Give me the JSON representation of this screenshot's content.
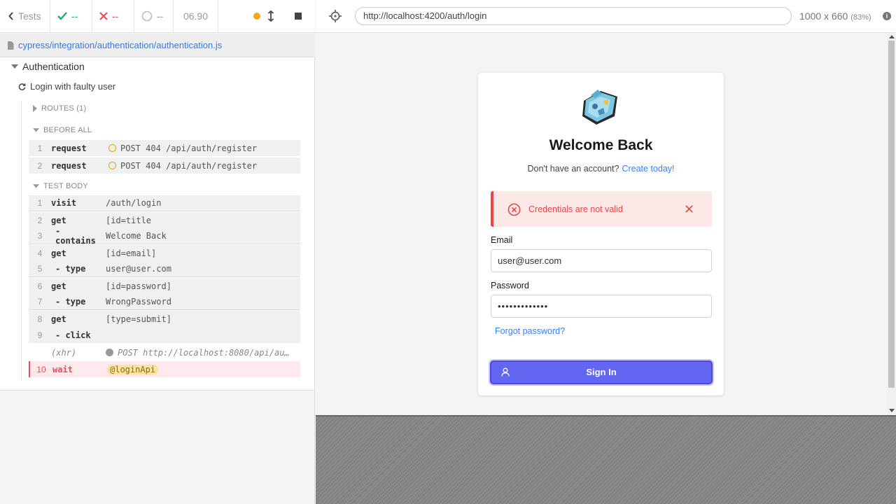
{
  "reporter": {
    "tests_label": "Tests",
    "passed": "--",
    "failed": "--",
    "pending": "--",
    "duration": "06.90",
    "spec_path": "cypress/integration/authentication/authentication.js",
    "suite_title": "Authentication",
    "test_title": "Login with faulty user",
    "routes_title": "ROUTES (1)",
    "before_all_title": "BEFORE ALL",
    "test_body_title": "TEST BODY",
    "before_all_commands": [
      {
        "num": "1",
        "name": "request",
        "msg": "POST 404 /api/auth/register"
      },
      {
        "num": "2",
        "name": "request",
        "msg": "POST 404 /api/auth/register"
      }
    ],
    "test_body_commands": [
      {
        "num": "1",
        "name": "visit",
        "msg": "/auth/login"
      },
      {
        "num": "2",
        "name": "get",
        "msg": "[id=title"
      },
      {
        "num": "3",
        "name": "- contains",
        "msg": "Welcome Back"
      },
      {
        "num": "4",
        "name": "get",
        "msg": "[id=email]"
      },
      {
        "num": "5",
        "name": "- type",
        "msg": "user@user.com"
      },
      {
        "num": "6",
        "name": "get",
        "msg": "[id=password]"
      },
      {
        "num": "7",
        "name": "- type",
        "msg": "WrongPassword"
      },
      {
        "num": "8",
        "name": "get",
        "msg": "[type=submit]"
      },
      {
        "num": "9",
        "name": "- click",
        "msg": ""
      },
      {
        "num": "",
        "name": "(xhr)",
        "msg": "POST http://localhost:8080/api/au…"
      },
      {
        "num": "10",
        "name": "wait",
        "msg": "@loginApi"
      }
    ]
  },
  "header": {
    "url": "http://localhost:4200/auth/login",
    "viewport": "1000 x 660",
    "scale": "(83%)"
  },
  "app": {
    "title": "Welcome Back",
    "signup_prompt": "Don't have an account?",
    "signup_link": "Create today!",
    "alert_message": "Credentials are not valid",
    "email_label": "Email",
    "email_value": "user@user.com",
    "password_label": "Password",
    "password_value": "•••••••••••••",
    "forgot_link": "Forgot password?",
    "signin_label": "Sign In"
  },
  "colors": {
    "accent": "#6366f1",
    "error": "#ef4444",
    "link": "#3b82f6",
    "pass": "#1fa971",
    "fail": "#e94e5a",
    "pending_ring": "#f0a500"
  }
}
